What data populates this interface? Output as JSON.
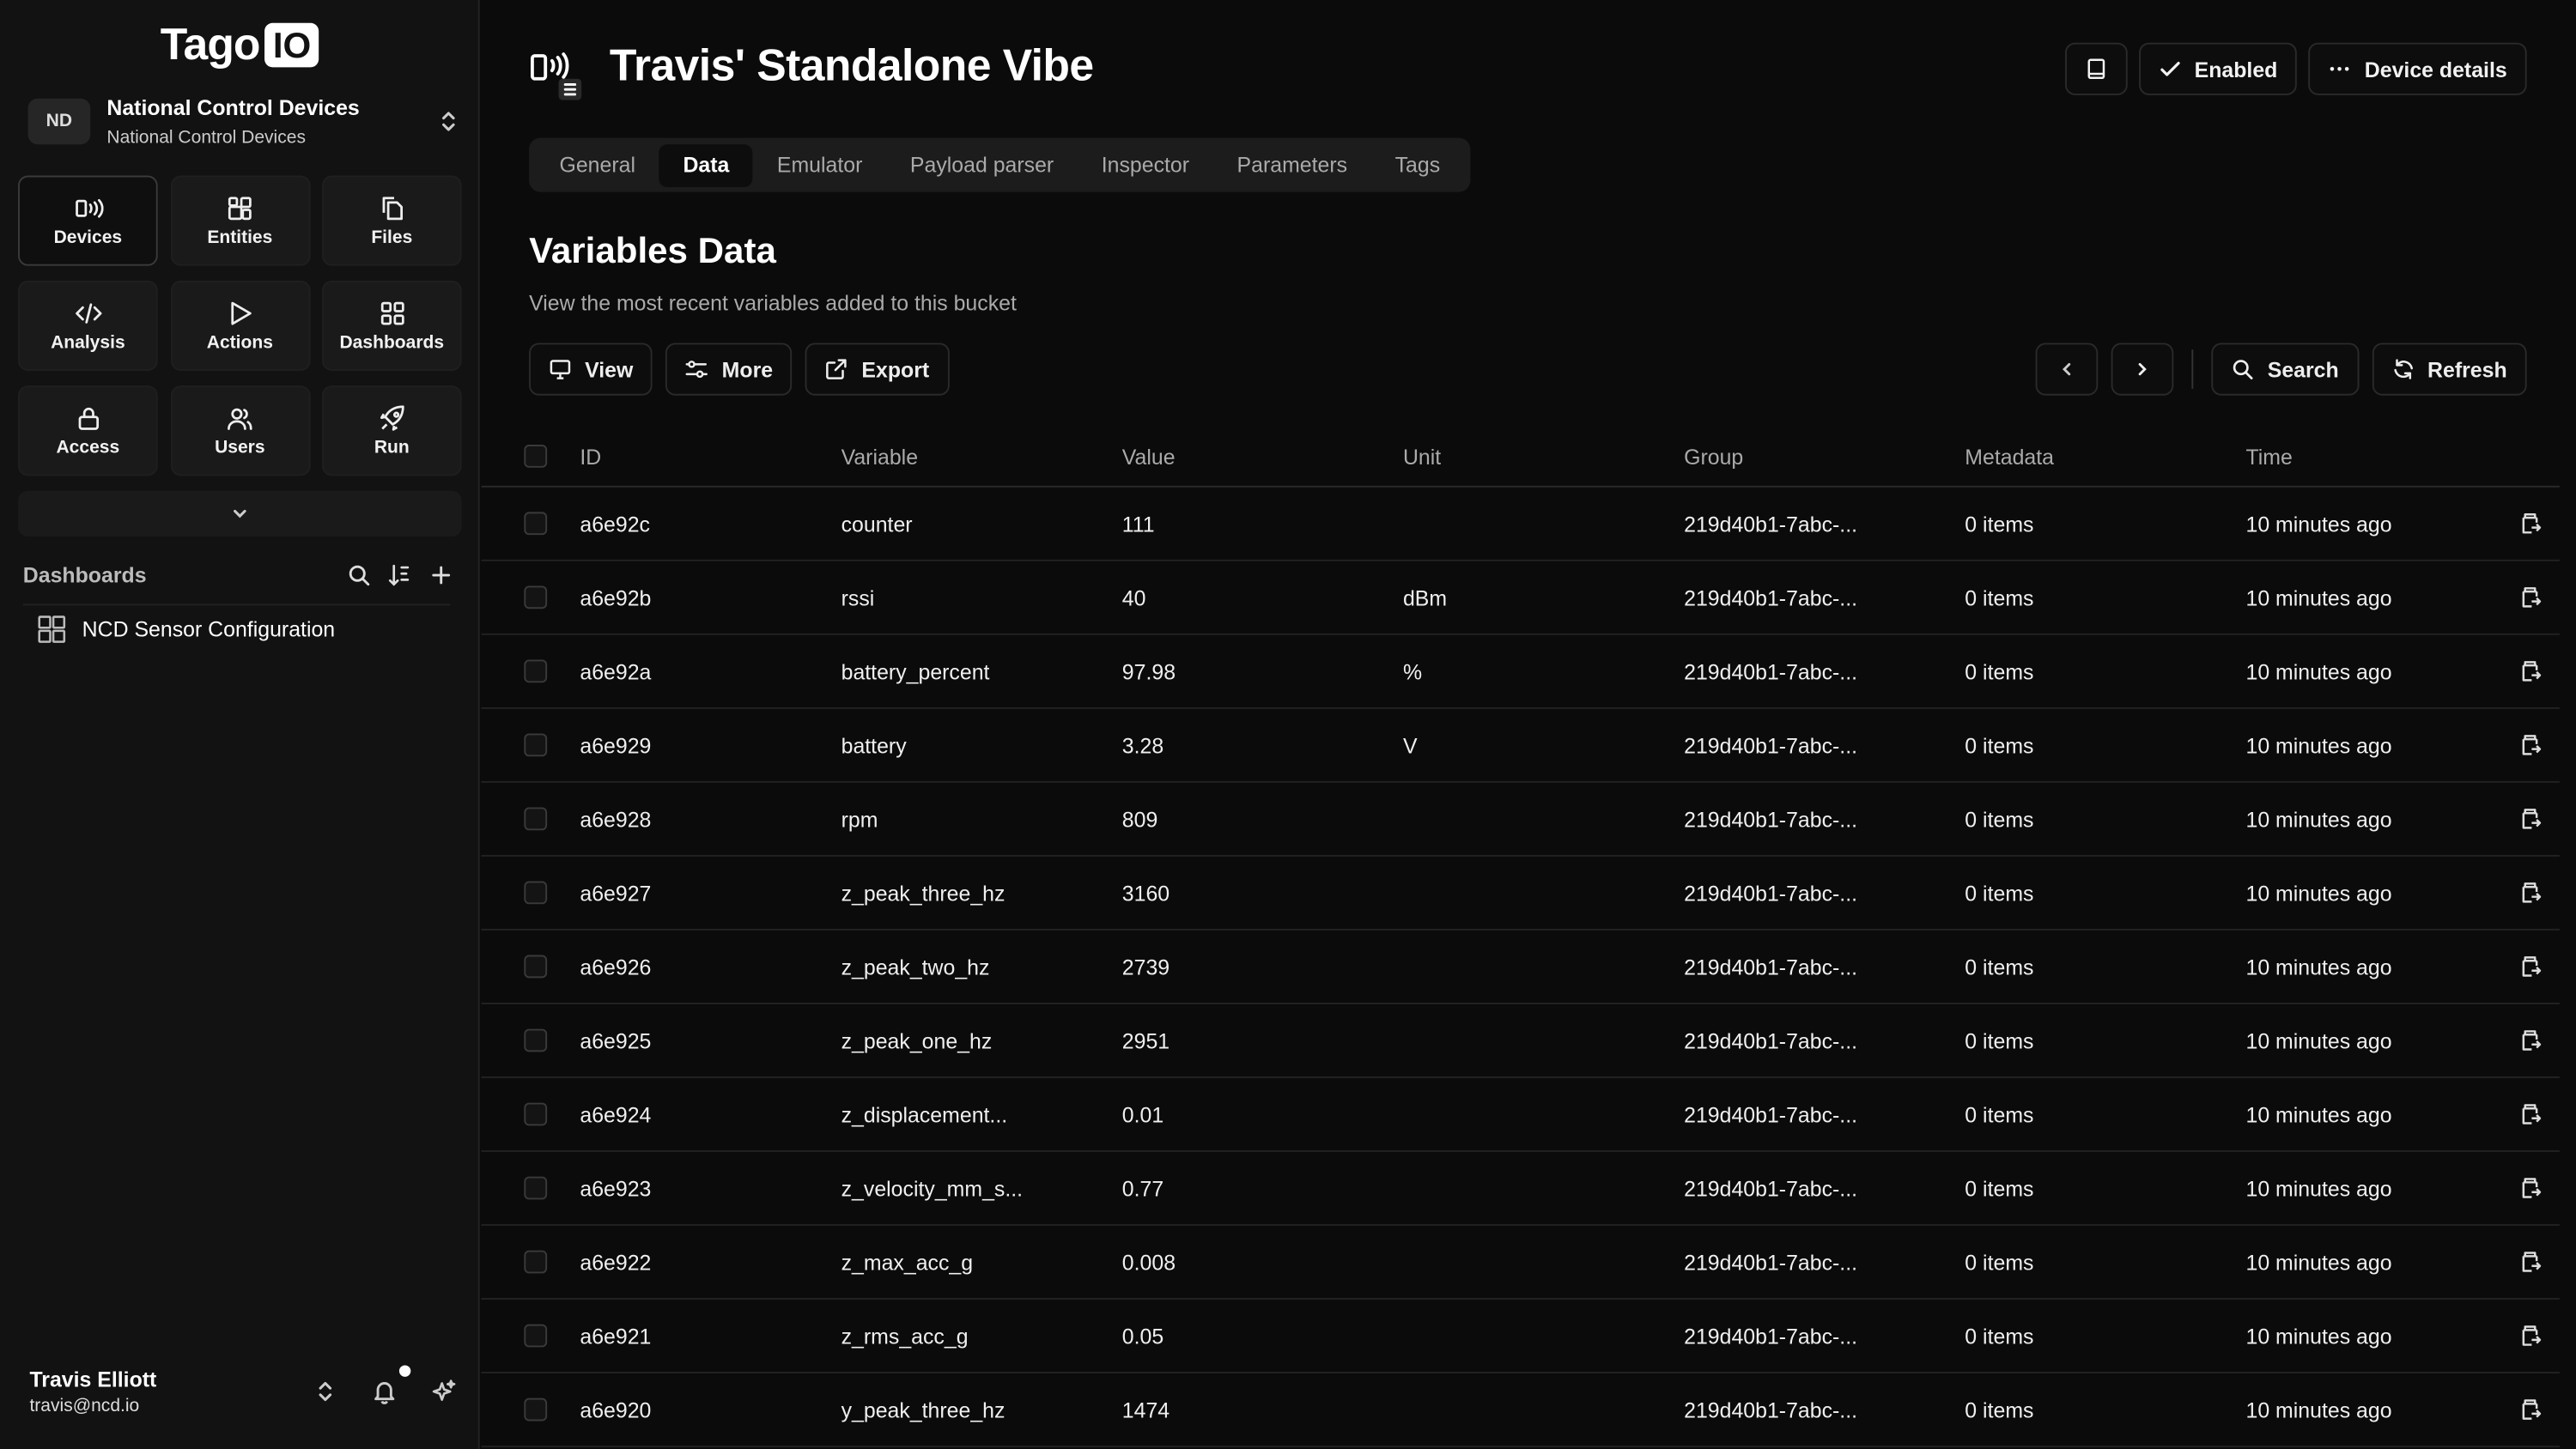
{
  "brand": {
    "logo_text": "Tago",
    "logo_box": "IO"
  },
  "org": {
    "badge": "ND",
    "name": "National Control Devices",
    "sub": "National Control Devices"
  },
  "nav": {
    "items": [
      {
        "label": "Devices",
        "icon": "devices-icon"
      },
      {
        "label": "Entities",
        "icon": "entities-icon"
      },
      {
        "label": "Files",
        "icon": "files-icon"
      },
      {
        "label": "Analysis",
        "icon": "code-icon"
      },
      {
        "label": "Actions",
        "icon": "play-icon"
      },
      {
        "label": "Dashboards",
        "icon": "grid-icon"
      },
      {
        "label": "Access",
        "icon": "lock-icon"
      },
      {
        "label": "Users",
        "icon": "users-icon"
      },
      {
        "label": "Run",
        "icon": "rocket-icon"
      }
    ]
  },
  "dashboards": {
    "title": "Dashboards",
    "items": [
      {
        "label": "NCD Sensor Configuration"
      }
    ]
  },
  "user": {
    "name": "Travis Elliott",
    "email": "travis@ncd.io"
  },
  "device": {
    "title": "Travis' Standalone Vibe"
  },
  "header": {
    "enabled_label": "Enabled",
    "details_label": "Device details"
  },
  "tabs": [
    "General",
    "Data",
    "Emulator",
    "Payload parser",
    "Inspector",
    "Parameters",
    "Tags"
  ],
  "active_tab": "Data",
  "section": {
    "title": "Variables Data",
    "subtitle": "View the most recent variables added to this bucket"
  },
  "toolbar": {
    "view": "View",
    "more": "More",
    "export": "Export",
    "search": "Search",
    "refresh": "Refresh"
  },
  "table": {
    "columns": [
      "ID",
      "Variable",
      "Value",
      "Unit",
      "Group",
      "Metadata",
      "Time"
    ],
    "rows": [
      [
        "a6e92c",
        "counter",
        "111",
        "",
        "219d40b1-7abc-...",
        "0 items",
        "10 minutes ago"
      ],
      [
        "a6e92b",
        "rssi",
        "40",
        "dBm",
        "219d40b1-7abc-...",
        "0 items",
        "10 minutes ago"
      ],
      [
        "a6e92a",
        "battery_percent",
        "97.98",
        "%",
        "219d40b1-7abc-...",
        "0 items",
        "10 minutes ago"
      ],
      [
        "a6e929",
        "battery",
        "3.28",
        "V",
        "219d40b1-7abc-...",
        "0 items",
        "10 minutes ago"
      ],
      [
        "a6e928",
        "rpm",
        "809",
        "",
        "219d40b1-7abc-...",
        "0 items",
        "10 minutes ago"
      ],
      [
        "a6e927",
        "z_peak_three_hz",
        "3160",
        "",
        "219d40b1-7abc-...",
        "0 items",
        "10 minutes ago"
      ],
      [
        "a6e926",
        "z_peak_two_hz",
        "2739",
        "",
        "219d40b1-7abc-...",
        "0 items",
        "10 minutes ago"
      ],
      [
        "a6e925",
        "z_peak_one_hz",
        "2951",
        "",
        "219d40b1-7abc-...",
        "0 items",
        "10 minutes ago"
      ],
      [
        "a6e924",
        "z_displacement...",
        "0.01",
        "",
        "219d40b1-7abc-...",
        "0 items",
        "10 minutes ago"
      ],
      [
        "a6e923",
        "z_velocity_mm_s...",
        "0.77",
        "",
        "219d40b1-7abc-...",
        "0 items",
        "10 minutes ago"
      ],
      [
        "a6e922",
        "z_max_acc_g",
        "0.008",
        "",
        "219d40b1-7abc-...",
        "0 items",
        "10 minutes ago"
      ],
      [
        "a6e921",
        "z_rms_acc_g",
        "0.05",
        "",
        "219d40b1-7abc-...",
        "0 items",
        "10 minutes ago"
      ],
      [
        "a6e920",
        "y_peak_three_hz",
        "1474",
        "",
        "219d40b1-7abc-...",
        "0 items",
        "10 minutes ago"
      ]
    ]
  }
}
